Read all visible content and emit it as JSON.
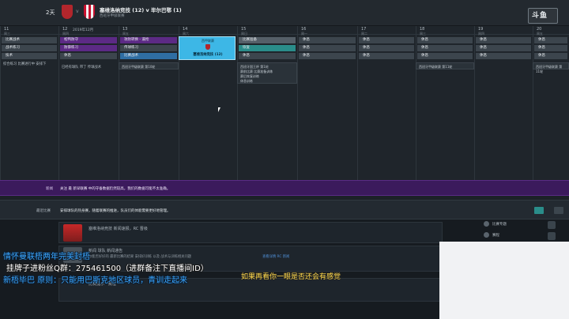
{
  "header": {
    "days": "2天",
    "vs": "v",
    "match_title": "塞维洛纳竞技 (12) v 毕尔巴鄂 (1)",
    "match_sub": "西班牙甲级联赛",
    "logo": "斗鱼",
    "room_id": "2083115"
  },
  "calendar": {
    "month": "2019年12月",
    "columns": [
      {
        "num": "11",
        "dow": "周三"
      },
      {
        "num": "12",
        "dow": "周四"
      },
      {
        "num": "13",
        "dow": "周五"
      },
      {
        "num": "14",
        "dow": "周六"
      },
      {
        "num": "15",
        "dow": "周日"
      },
      {
        "num": "16",
        "dow": "周一"
      },
      {
        "num": "17",
        "dow": "周二"
      },
      {
        "num": "18",
        "dow": "周三"
      },
      {
        "num": "19",
        "dow": "周四"
      },
      {
        "num": "20",
        "dow": "周五"
      }
    ],
    "col11_tiles": [
      "比赛战术",
      "战术练习",
      "技术"
    ],
    "col12_tiles": [
      "松鸭防守",
      "防御练习",
      "休息"
    ],
    "col13_tiles": [
      "攻防转换 - 逼抢",
      "传球练习",
      "比赛战术"
    ],
    "match_card": {
      "time": "西甲联赛",
      "name": "塞维洛纳竞技 (12)"
    },
    "col15_tiles": [
      "比赛准备",
      "恢复",
      "休息"
    ],
    "rest": "休息",
    "col11_side": "综合练习 比赛进行中 安排下",
    "col12_side": "已经有球队 带了 传球战术",
    "card_13": "西班牙甲级联赛 第10轮",
    "card_15": [
      "西班牙国王杯 第1轮",
      "赛前比赛 比赛准备训练",
      "赛后恢复训练",
      "休息训练"
    ],
    "card_18": "西班牙甲级联赛 第11轮",
    "card_20": "西班牙甲级联赛 第11轮"
  },
  "news": {
    "label": "新闻",
    "text": "关注 最 新早联赛 中的守备数据仍然较高，我们的数据可能不太准确。"
  },
  "briefing": {
    "label": "最近比赛",
    "text": "安排球队的热身赛，随着联赛的推进，队员们的体能需要更好地管理。"
  },
  "feed": {
    "item1_title": "塞维洛纳竞技 新闻速报，RC 晋级",
    "item2_title": "新闻 球队 新闻通告",
    "item2_line": "你能否好好的 最新比赛的结果 安排好训练 以及 战术与训练相关问题",
    "item2_link": "查看详情 RC 新闻",
    "item3_title": "比赛提示 · 赛程",
    "right_items": [
      "比赛专题",
      "赛程",
      "转会",
      "联赛"
    ]
  },
  "overlay": {
    "line1": "情怀曼联梧两年完美封梧",
    "line2": "挂牌子进粉丝Q群：275461500（进群备注下直播间ID）",
    "line3": "新梧毕巴 原则：只能用巴斯克地区球员，青训走起来",
    "subtitle": "如果再看你一眼是否还会有感觉"
  },
  "colors": {
    "purple": "#5c2a85",
    "blue": "#2f6ea3",
    "teal": "#2a8d8a",
    "match": "#3db7e6"
  }
}
